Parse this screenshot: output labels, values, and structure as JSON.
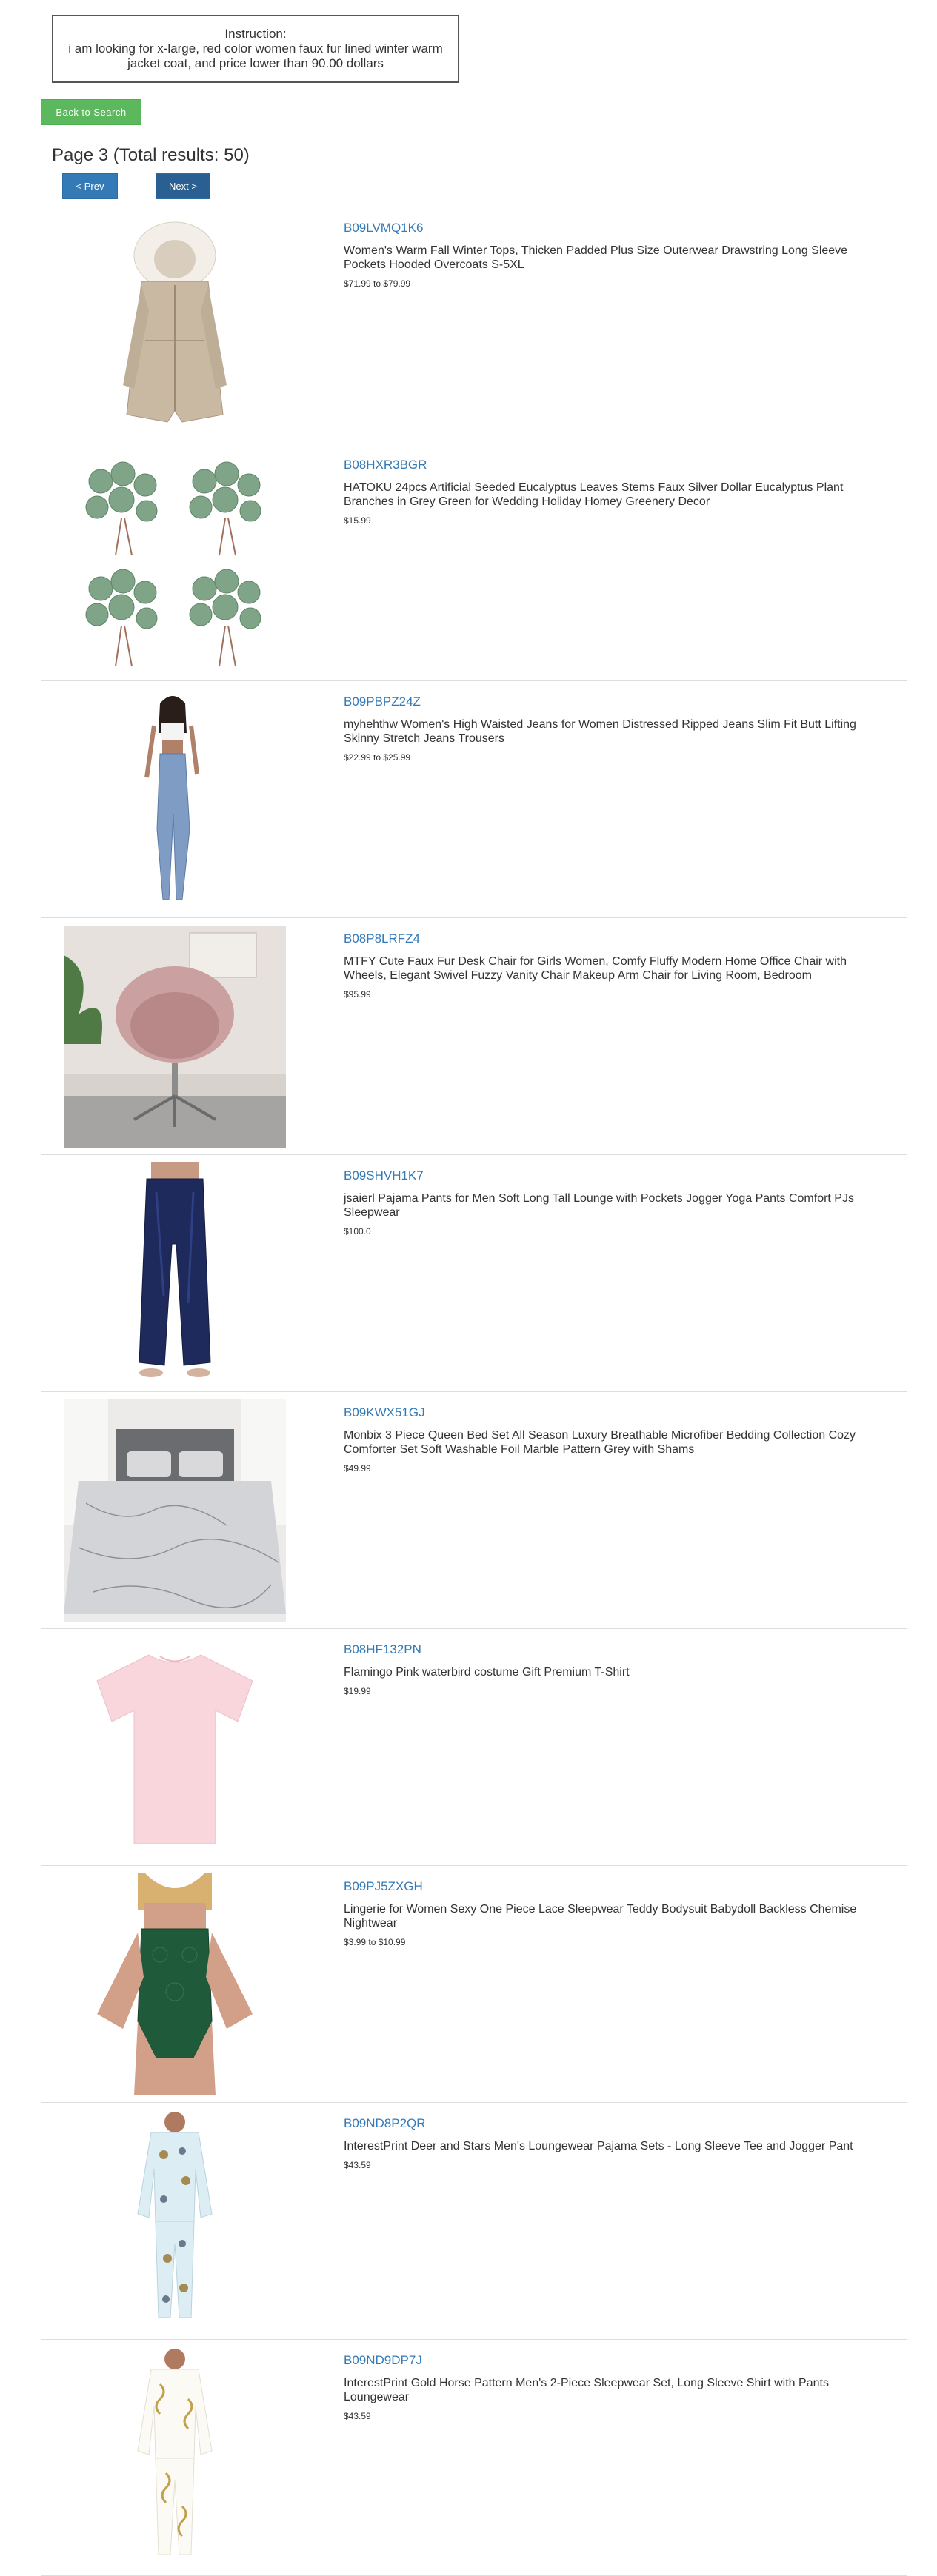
{
  "instruction": {
    "heading": "Instruction:",
    "text": "i am looking for x-large, red color women faux fur lined winter warm jacket coat, and price lower than 90.00 dollars"
  },
  "buttons": {
    "back": "Back to Search",
    "prev": "< Prev",
    "next": "Next >"
  },
  "page_title": "Page 3 (Total results: 50)",
  "results": [
    {
      "asin": "B09LVMQ1K6",
      "title": "Women's Warm Fall Winter Tops, Thicken Padded Plus Size Outerwear Drawstring Long Sleeve Pockets Hooded Overcoats S-5XL",
      "price": "$71.99 to $79.99",
      "image": "beige-hooded-parka"
    },
    {
      "asin": "B08HXR3BGR",
      "title": "HATOKU 24pcs Artificial Seeded Eucalyptus Leaves Stems Faux Silver Dollar Eucalyptus Plant Branches in Grey Green for Wedding Holiday Homey Greenery Decor",
      "price": "$15.99",
      "image": "eucalyptus-stems"
    },
    {
      "asin": "B09PBPZ24Z",
      "title": "myhehthw Women's High Waisted Jeans for Women Distressed Ripped Jeans Slim Fit Butt Lifting Skinny Stretch Jeans Trousers",
      "price": "$22.99 to $25.99",
      "image": "ripped-jeans-model"
    },
    {
      "asin": "B08P8LRFZ4",
      "title": "MTFY Cute Faux Fur Desk Chair for Girls Women, Comfy Fluffy Modern Home Office Chair with Wheels, Elegant Swivel Fuzzy Vanity Chair Makeup Arm Chair for Living Room, Bedroom",
      "price": "$95.99",
      "image": "pink-fur-chair"
    },
    {
      "asin": "B09SHVH1K7",
      "title": "jsaierl Pajama Pants for Men Soft Long Tall Lounge with Pockets Jogger Yoga Pants Comfort PJs Sleepwear",
      "price": "$100.0",
      "image": "navy-satin-pants"
    },
    {
      "asin": "B09KWX51GJ",
      "title": "Monbix 3 Piece Queen Bed Set All Season Luxury Breathable Microfiber Bedding Collection Cozy Comforter Set Soft Washable Foil Marble Pattern Grey with Shams",
      "price": "$49.99",
      "image": "marble-bed-set"
    },
    {
      "asin": "B08HF132PN",
      "title": "Flamingo Pink waterbird costume Gift Premium T-Shirt",
      "price": "$19.99",
      "image": "pink-t-shirt"
    },
    {
      "asin": "B09PJ5ZXGH",
      "title": "Lingerie for Women Sexy One Piece Lace Sleepwear Teddy Bodysuit Babydoll Backless Chemise Nightwear",
      "price": "$3.99 to $10.99",
      "image": "green-lace-bodysuit"
    },
    {
      "asin": "B09ND8P2QR",
      "title": "InterestPrint Deer and Stars Men's Loungewear Pajama Sets - Long Sleeve Tee and Jogger Pant",
      "price": "$43.59",
      "image": "deer-pajama-set"
    },
    {
      "asin": "B09ND9DP7J",
      "title": "InterestPrint Gold Horse Pattern Men's 2-Piece Sleepwear Set, Long Sleeve Shirt with Pants Loungewear",
      "price": "$43.59",
      "image": "gold-pattern-pajama-set"
    }
  ],
  "colors": {
    "asin_link": "#337ab7",
    "back_button": "#5cb85c",
    "nav_button": "#337ab7"
  }
}
